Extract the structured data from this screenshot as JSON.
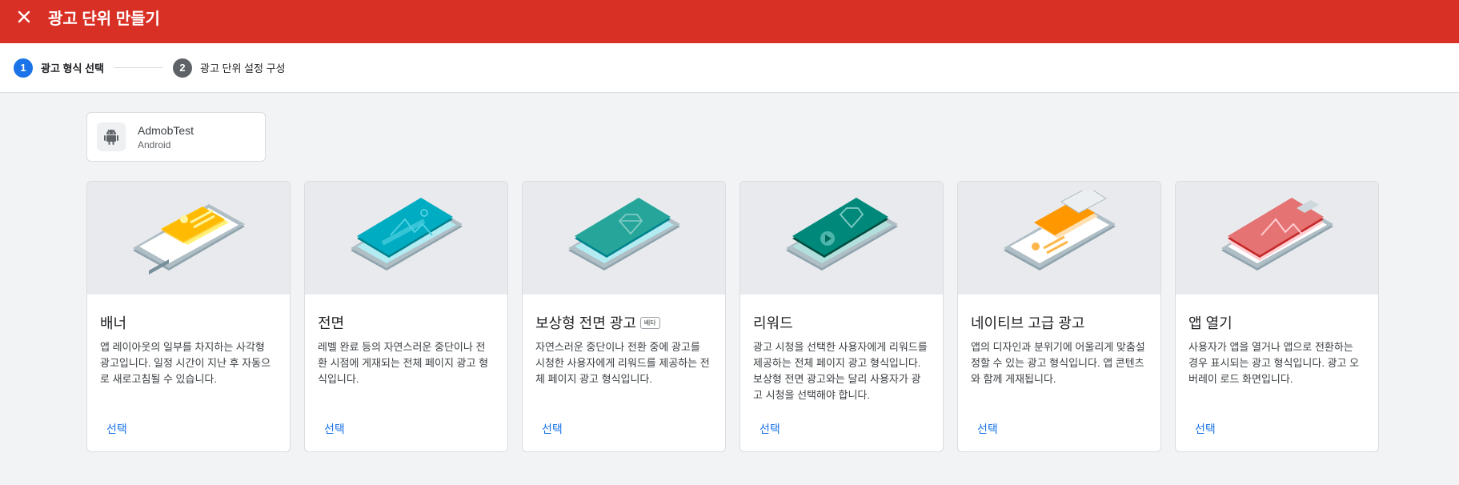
{
  "header": {
    "title": "광고 단위 만들기",
    "close_icon": "close-icon"
  },
  "stepper": {
    "steps": [
      {
        "number": "1",
        "label": "광고 형식 선택",
        "state": "active"
      },
      {
        "number": "2",
        "label": "광고 단위 설정 구성",
        "state": "inactive"
      }
    ]
  },
  "app": {
    "name": "AdmobTest",
    "platform": "Android",
    "icon": "android-icon"
  },
  "cards": [
    {
      "title": "배너",
      "badge": "",
      "description": "앱 레이아웃의 일부를 차지하는 사각형 광고입니다. 일정 시간이 지난 후 자동으로 새로고침될 수 있습니다.",
      "select_label": "선택",
      "icon": "banner-illustration"
    },
    {
      "title": "전면",
      "badge": "",
      "description": "레벨 완료 등의 자연스러운 중단이나 전환 시점에 게재되는 전체 페이지 광고 형식입니다.",
      "select_label": "선택",
      "icon": "interstitial-illustration"
    },
    {
      "title": "보상형 전면 광고",
      "badge": "베타",
      "description": "자연스러운 중단이나 전환 중에 광고를 시청한 사용자에게 리워드를 제공하는 전체 페이지 광고 형식입니다.",
      "select_label": "선택",
      "icon": "rewarded-interstitial-illustration"
    },
    {
      "title": "리워드",
      "badge": "",
      "description": "광고 시청을 선택한 사용자에게 리워드를 제공하는 전체 페이지 광고 형식입니다. 보상형 전면 광고와는 달리 사용자가 광고 시청을 선택해야 합니다.",
      "select_label": "선택",
      "icon": "rewarded-illustration"
    },
    {
      "title": "네이티브 고급 광고",
      "badge": "",
      "description": "앱의 디자인과 분위기에 어울리게 맞춤설정할 수 있는 광고 형식입니다. 앱 콘텐츠와 함께 게재됩니다.",
      "select_label": "선택",
      "icon": "native-advanced-illustration"
    },
    {
      "title": "앱 열기",
      "badge": "",
      "description": "사용자가 앱을 열거나 앱으로 전환하는 경우 표시되는 광고 형식입니다. 광고 오버레이 로드 화면입니다.",
      "select_label": "선택",
      "icon": "app-open-illustration"
    }
  ],
  "colors": {
    "header_bg": "#d93025",
    "accent": "#1a73e8",
    "background": "#f1f3f4"
  }
}
